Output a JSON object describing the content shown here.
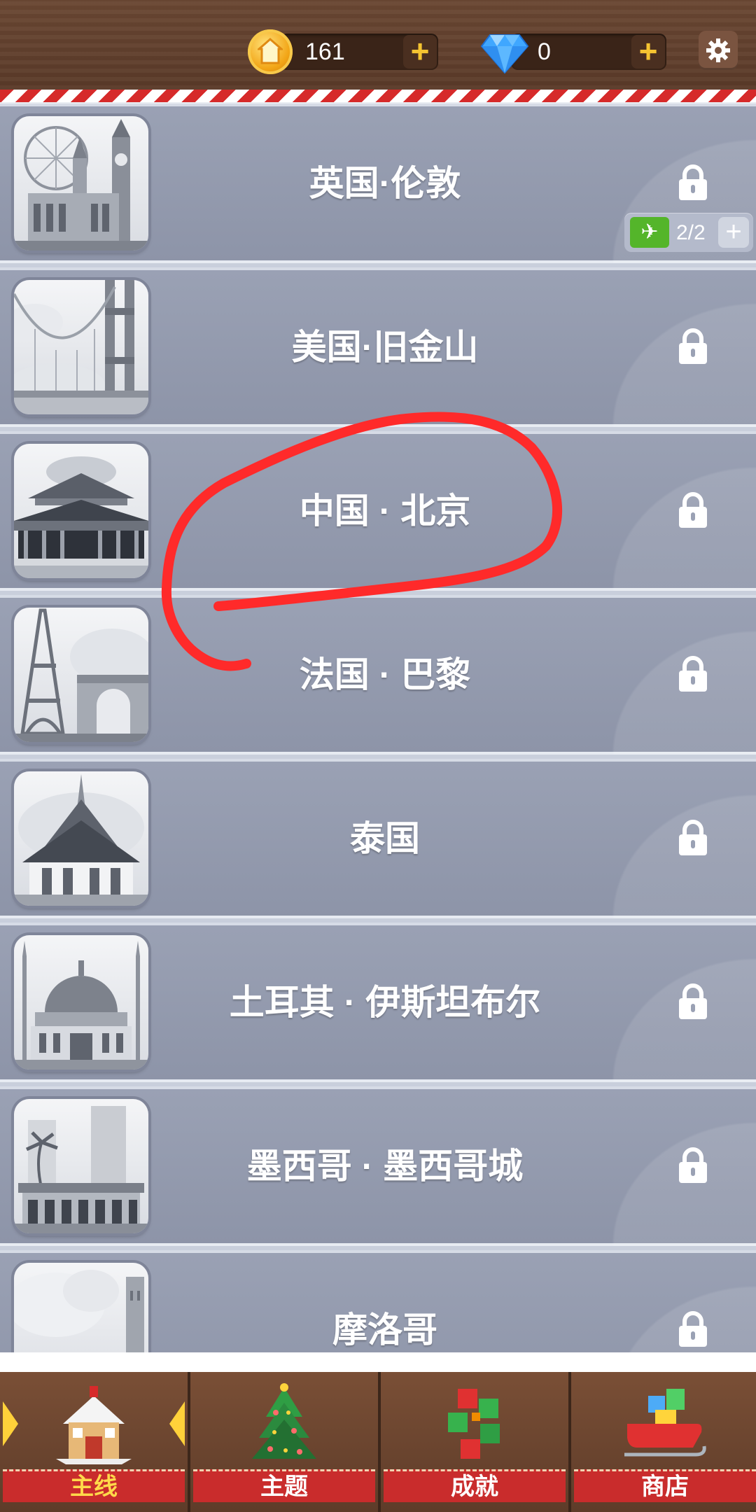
{
  "header": {
    "coins": "161",
    "gems": "0",
    "plus_label": "+"
  },
  "cities": [
    {
      "name": "英国·伦敦",
      "locked": true,
      "flights": "2/2"
    },
    {
      "name": "美国·旧金山",
      "locked": true
    },
    {
      "name": "中国 · 北京",
      "locked": true
    },
    {
      "name": "法国 · 巴黎",
      "locked": true
    },
    {
      "name": "泰国",
      "locked": true
    },
    {
      "name": "土耳其 · 伊斯坦布尔",
      "locked": true
    },
    {
      "name": "墨西哥 · 墨西哥城",
      "locked": true
    },
    {
      "name": "摩洛哥",
      "locked": true
    }
  ],
  "nav": [
    {
      "label": "主线",
      "icon": "gingerbread-house-icon",
      "active": true
    },
    {
      "label": "主题",
      "icon": "christmas-tree-icon",
      "active": false
    },
    {
      "label": "成就",
      "icon": "achievement-blocks-icon",
      "active": false
    },
    {
      "label": "商店",
      "icon": "sleigh-gifts-icon",
      "active": false
    }
  ],
  "colors": {
    "accent_yellow": "#ffd94a",
    "nav_red": "#c92c2c",
    "card_bg": "#9aa1b4",
    "annotation_red": "#ff2a2a"
  }
}
